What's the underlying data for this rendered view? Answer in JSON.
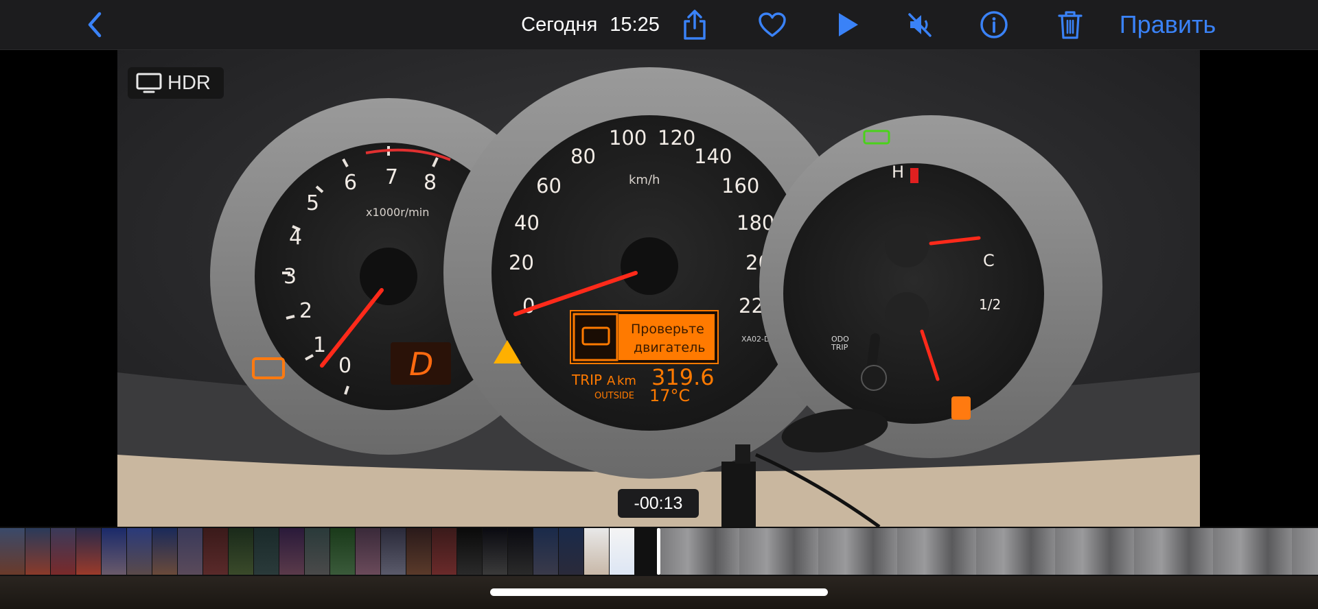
{
  "topbar": {
    "date": "Сегодня",
    "time": "15:25",
    "edit_label": "Править"
  },
  "video": {
    "hdr_label": "HDR",
    "remaining_time": "-00:13"
  },
  "dashboard": {
    "tach_numbers": [
      "0",
      "1",
      "2",
      "3",
      "4",
      "5",
      "6",
      "7",
      "8"
    ],
    "tach_unit": "x1000r/min",
    "gear": "D",
    "speed_numbers": [
      "0",
      "20",
      "40",
      "60",
      "80",
      "100",
      "120",
      "140",
      "160",
      "180",
      "200",
      "220"
    ],
    "speed_unit": "km/h",
    "msg_line1": "Проверьте",
    "msg_line2": "двигатель",
    "trip_label": "TRIP",
    "trip_letter": "A",
    "trip_unit": "km",
    "trip_value": "319.6",
    "outside_label": "OUTSIDE",
    "outside_temp": "17°C",
    "code": "XA02-D",
    "odo_label": "ODO",
    "odo_trip_label": "TRIP",
    "temp_high": "H",
    "temp_low": "C",
    "fuel_half": "1/2"
  },
  "colors": {
    "accent": "#3a82f7",
    "needle": "#ff2a1a",
    "display_orange": "#ff7a00"
  }
}
